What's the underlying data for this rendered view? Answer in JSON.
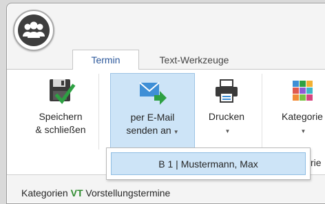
{
  "tabs": [
    {
      "label": "Termin",
      "active": true
    },
    {
      "label": "Text-Werkzeuge",
      "active": false
    }
  ],
  "app_button": {
    "icon": "users-group-icon"
  },
  "ribbon": {
    "save": {
      "line1": "Speichern",
      "line2": "& schließen",
      "icon": "floppy-disk-check-icon"
    },
    "mail": {
      "line1": "per E-Mail",
      "line2": "senden an",
      "icon": "email-forward-icon",
      "has_dropdown": true
    },
    "print": {
      "label": "Drucken",
      "icon": "printer-icon",
      "has_dropdown": true
    },
    "category": {
      "label": "Kategorie",
      "icon": "category-grid-icon",
      "has_dropdown": true
    }
  },
  "dropdown": {
    "items": [
      {
        "label": "B 1 | Mustermann, Max"
      }
    ]
  },
  "partial_text": "rie",
  "bottom": {
    "prefix": "Kategorien",
    "vt": "VT",
    "suffix": "Vorstellungstermine"
  },
  "colors": {
    "accent_tab": "#2b579a",
    "highlight": "#cde4f7",
    "highlight_border": "#9cc3e5",
    "check_green": "#2ea043"
  }
}
